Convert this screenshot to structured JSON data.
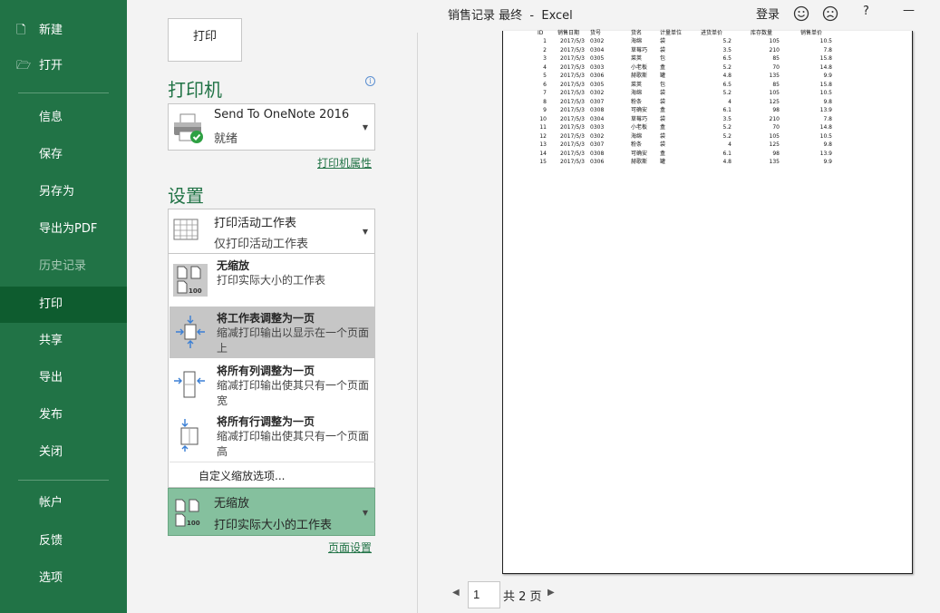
{
  "window": {
    "title": "销售记录 最终  -  Excel",
    "signin": "登录",
    "help": "?",
    "minimize": "—"
  },
  "sidebar": {
    "items": [
      {
        "label": "新建",
        "icon": "new-icon"
      },
      {
        "label": "打开",
        "icon": "folder-open-icon"
      },
      {
        "label": "信息"
      },
      {
        "label": "保存"
      },
      {
        "label": "另存为"
      },
      {
        "label": "导出为PDF"
      },
      {
        "label": "历史记录",
        "disabled": true
      },
      {
        "label": "打印",
        "active": true
      },
      {
        "label": "共享"
      },
      {
        "label": "导出"
      },
      {
        "label": "发布"
      },
      {
        "label": "关闭"
      },
      {
        "label": "帐户"
      },
      {
        "label": "反馈"
      },
      {
        "label": "选项"
      }
    ]
  },
  "print_panel": {
    "print_button": "打印",
    "printer_heading": "打印机",
    "printer_name": "Send To OneNote 2016",
    "printer_status": "就绪",
    "printer_properties": "打印机属性",
    "settings_heading": "设置",
    "scope_main": "打印活动工作表",
    "scope_sub": "仅打印活动工作表",
    "scaling_options": [
      {
        "title": "无缩放",
        "desc": "打印实际大小的工作表",
        "icon": "no-scaling-icon"
      },
      {
        "title": "将工作表调整为一页",
        "desc": "缩减打印输出以显示在一个页面上",
        "icon": "fit-sheet-icon",
        "selected": true
      },
      {
        "title": "将所有列调整为一页",
        "desc": "缩减打印输出使其只有一个页面宽",
        "icon": "fit-columns-icon"
      },
      {
        "title": "将所有行调整为一页",
        "desc": "缩减打印输出使其只有一个页面高",
        "icon": "fit-rows-icon"
      }
    ],
    "custom_scaling": "自定义缩放选项...",
    "current_scaling_main": "无缩放",
    "current_scaling_sub": "打印实际大小的工作表",
    "page_setup": "页面设置",
    "icon_badge": "100"
  },
  "preview": {
    "headers": [
      "ID",
      "销售日期",
      "货号",
      "货名",
      "计量单位",
      "进货单价",
      "库存数量",
      "销售单价"
    ],
    "rows": [
      [
        "1",
        "2017/5/3",
        "0302",
        "海绵",
        "袋",
        "5.2",
        "105",
        "10.5"
      ],
      [
        "2",
        "2017/5/3",
        "0304",
        "草莓巧",
        "袋",
        "3.5",
        "210",
        "7.8"
      ],
      [
        "3",
        "2017/5/3",
        "0305",
        "菜荚",
        "包",
        "6.5",
        "85",
        "15.8"
      ],
      [
        "4",
        "2017/5/3",
        "0303",
        "小老板",
        "盒",
        "5.2",
        "70",
        "14.8"
      ],
      [
        "5",
        "2017/5/3",
        "0306",
        "赫歌斯",
        "罐",
        "4.8",
        "135",
        "9.9"
      ],
      [
        "6",
        "2017/5/3",
        "0305",
        "菜荚",
        "包",
        "6.5",
        "85",
        "15.8"
      ],
      [
        "7",
        "2017/5/3",
        "0302",
        "海绵",
        "袋",
        "5.2",
        "105",
        "10.5"
      ],
      [
        "8",
        "2017/5/3",
        "0307",
        "粉条",
        "袋",
        "4",
        "125",
        "9.8"
      ],
      [
        "9",
        "2017/5/3",
        "0308",
        "可确安",
        "盒",
        "6.1",
        "98",
        "13.9"
      ],
      [
        "10",
        "2017/5/3",
        "0304",
        "草莓巧",
        "袋",
        "3.5",
        "210",
        "7.8"
      ],
      [
        "11",
        "2017/5/3",
        "0303",
        "小老板",
        "盒",
        "5.2",
        "70",
        "14.8"
      ],
      [
        "12",
        "2017/5/3",
        "0302",
        "海绵",
        "袋",
        "5.2",
        "105",
        "10.5"
      ],
      [
        "13",
        "2017/5/3",
        "0307",
        "粉条",
        "袋",
        "4",
        "125",
        "9.8"
      ],
      [
        "14",
        "2017/5/3",
        "0308",
        "可确安",
        "盒",
        "6.1",
        "98",
        "13.9"
      ],
      [
        "15",
        "2017/5/3",
        "0306",
        "赫歌斯",
        "罐",
        "4.8",
        "135",
        "9.9"
      ]
    ],
    "current_page": "1",
    "total_pages": "共 2 页"
  },
  "colors": {
    "accent": "#217346",
    "sidebar_active": "#0e5c2f",
    "selected_scaling": "#85c09e"
  }
}
